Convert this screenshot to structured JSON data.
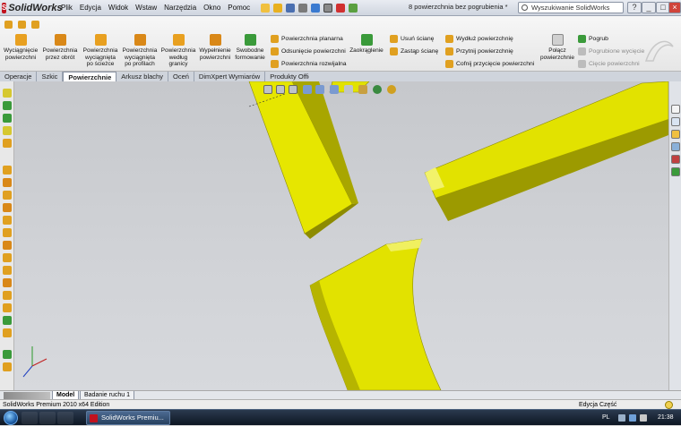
{
  "app": {
    "name": "SolidWorks",
    "doc_title": "8 powierzchnia bez pogrubienia *"
  },
  "menu": [
    "Plik",
    "Edycja",
    "Widok",
    "Wstaw",
    "Narzędzia",
    "Okno",
    "Pomoc"
  ],
  "search": {
    "placeholder": "Wyszukiwanie SolidWorks"
  },
  "window_buttons": [
    "?",
    "_",
    "□",
    "×"
  ],
  "commands": {
    "big": [
      {
        "label": "Wyciągnięcie\npowierzchni",
        "color": "#e8a020"
      },
      {
        "label": "Powierzchnia\nprzez obrót",
        "color": "#e8a020"
      },
      {
        "label": "Powierzchnia\nwyciągnięta\npo ścieżce",
        "color": "#e8a020"
      },
      {
        "label": "Powierzchnia\nwyciągnięta\npo profilach",
        "color": "#e8a020"
      },
      {
        "label": "Powierzchnia\nwedług\ngranicy",
        "color": "#e8a020"
      },
      {
        "label": "Wypełnienie\npowierzchni",
        "color": "#e8a020"
      },
      {
        "label": "Swobodne\nformowanie",
        "color": "#e8a020"
      }
    ],
    "col1": [
      "Powierzchnia planarna",
      "Odsunięcie powierzchni",
      "Powierzchnia rozwijalna"
    ],
    "zaokraglenie": "Zaokrąglenie",
    "col2": [
      "Usuń ścianę",
      "Zastąp ścianę"
    ],
    "col3": [
      "Wydłuż powierzchnię",
      "Przytnij powierzchnię",
      "Cofnij przycięcie powierzchni"
    ],
    "polacz": "Połącz\npowierzchnie",
    "col4": [
      "Pogrub",
      "Pogrubione wycięcie",
      "Cięcie powierzchni"
    ]
  },
  "tabs": [
    "Operacje",
    "Szkic",
    "Powierzchnie",
    "Arkusz blachy",
    "Oceń",
    "DimXpert Wymiarów",
    "Produkty Office"
  ],
  "active_tab": "Powierzchnie",
  "model_tabs": [
    "Model",
    "Badanie ruchu 1"
  ],
  "status": {
    "left": "SolidWorks Premium 2010 x64 Edition",
    "right": "Edycja Część"
  },
  "taskbar": {
    "task": "SolidWorks Premiu...",
    "lang": "PL",
    "time": "21:38"
  },
  "colors": {
    "part_yellow": "#e2e200",
    "part_shadow": "#9c9a00",
    "accent": "#c1121f"
  }
}
